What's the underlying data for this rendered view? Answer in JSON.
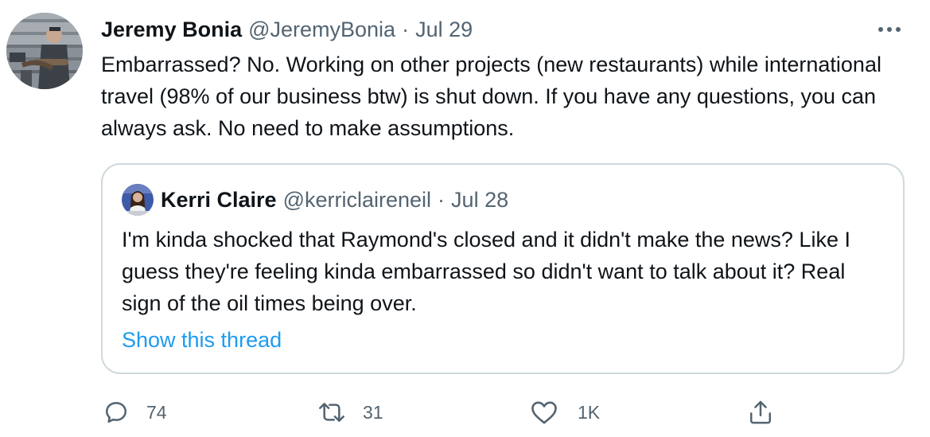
{
  "tweet": {
    "author_name": "Jeremy Bonia",
    "author_handle": "@JeremyBonia",
    "separator": "·",
    "date": "Jul 29",
    "more_icon": "more-horizontal-icon",
    "text": "Embarrassed? No. Working on other projects (new restaurants) while international travel (98% of our business btw) is shut down. If you have any questions, you can always ask. No need to make assumptions."
  },
  "quote": {
    "author_name": "Kerri Claire",
    "author_handle": "@kerriclaireneil",
    "separator": "·",
    "date": "Jul 28",
    "text": "I'm kinda shocked that Raymond's closed and it didn't make the news? Like I guess they're feeling kinda embarrassed so didn't want to talk about it? Real sign of the oil times being over.",
    "show_thread_label": "Show this thread"
  },
  "actions": {
    "reply_count": "74",
    "retweet_count": "31",
    "like_count": "1K",
    "reply_icon": "reply-icon",
    "retweet_icon": "retweet-icon",
    "like_icon": "heart-icon",
    "share_icon": "share-icon"
  },
  "colors": {
    "text": "#0f1419",
    "secondary": "#536471",
    "link": "#1d9bf0",
    "border": "#cfd9de"
  }
}
